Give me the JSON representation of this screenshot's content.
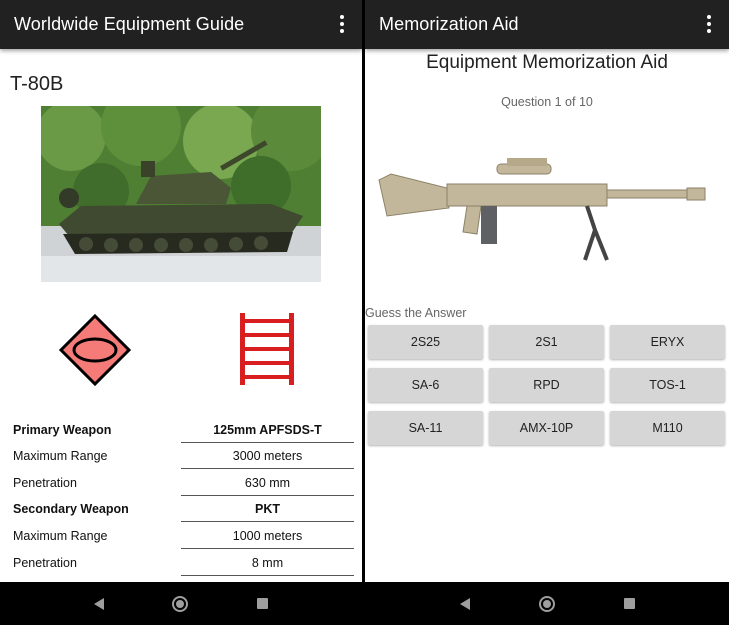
{
  "left": {
    "app_title": "Worldwide Equipment Guide",
    "equipment_name": "T-80B",
    "specs": [
      {
        "label": "Primary Weapon",
        "value": "125mm APFSDS-T",
        "bold": true
      },
      {
        "label": "Maximum Range",
        "value": "3000 meters",
        "bold": false
      },
      {
        "label": "Penetration",
        "value": "630 mm",
        "bold": false
      },
      {
        "label": "Secondary Weapon",
        "value": "PKT",
        "bold": true
      },
      {
        "label": "Maximum Range",
        "value": "1000 meters",
        "bold": false
      },
      {
        "label": "Penetration",
        "value": "8 mm",
        "bold": false
      }
    ],
    "colors": {
      "insignia_fill": "#f47b78",
      "track_icon": "#d81e1e"
    }
  },
  "right": {
    "app_title": "Memorization Aid",
    "quiz_title": "Equipment Memorization Aid",
    "progress": "Question 1 of 10",
    "guess_label": "Guess the Answer",
    "answers": [
      "2S25",
      "2S1",
      "ERYX",
      "SA-6",
      "RPD",
      "TOS-1",
      "SA-11",
      "AMX-10P",
      "M110"
    ]
  },
  "icons": {
    "overflow": "more-vert-icon",
    "nav_back": "back-icon",
    "nav_home": "home-icon",
    "nav_recent": "recents-icon"
  }
}
